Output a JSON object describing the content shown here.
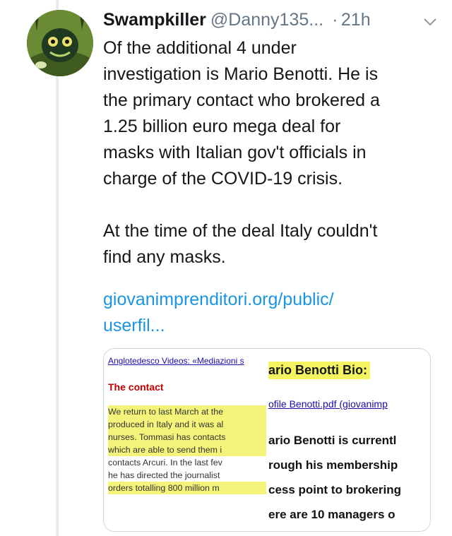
{
  "tweet": {
    "display_name": "Swampkiller",
    "handle": "@Danny135...",
    "separator": "·",
    "time": "21h",
    "lines_para1": [
      "Of the additional 4 under",
      "investigation is Mario Benotti. He is",
      "the primary contact who brokered a",
      "1.25 billion euro mega deal for",
      "masks with Italian gov't officials in",
      "charge of the COVID-19 crisis."
    ],
    "lines_para2": [
      "At the time of the deal Italy couldn't",
      "find any masks."
    ],
    "link_line1": "giovanimprenditori.org/public/",
    "link_line2": "userfil..."
  },
  "card": {
    "left": {
      "title": "Anglotedesco Videos: «Mediazioni s",
      "heading": "The contact",
      "lines": [
        "We return to last March at the",
        "produced in Italy and it was al",
        "nurses. Tommasi has contacts",
        "which are able to send them i",
        "contacts Arcuri. In the last fev",
        "he has directed the journalist",
        "orders totalling 800 million m"
      ]
    },
    "right": {
      "title": "ario Benotti Bio:",
      "link": "ofile Benotti.pdf (giovanimp",
      "lines": [
        "ario Benotti is currentl",
        "rough his membership",
        "cess point to brokering",
        "ere are 10 managers o"
      ]
    }
  },
  "colors": {
    "link": "#1b95e0",
    "secondary_text": "#657786",
    "highlight": "#f4f47a",
    "heading_red": "#c00000"
  },
  "icons": {
    "avatar": "swamp-creature-avatar",
    "menu": "chevron-down-icon"
  }
}
